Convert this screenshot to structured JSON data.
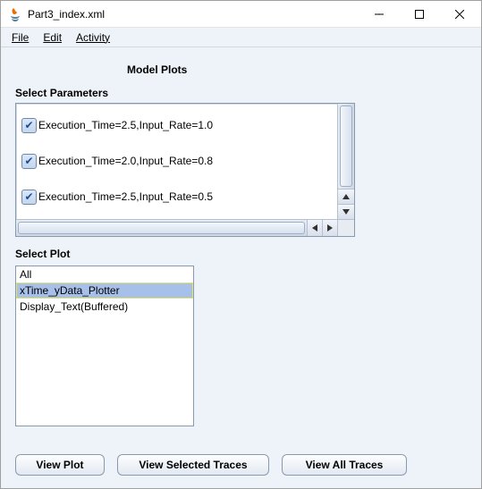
{
  "window": {
    "title": "Part3_index.xml"
  },
  "menu": {
    "file": "File",
    "edit": "Edit",
    "activity": "Activity"
  },
  "headings": {
    "model_plots": "Model Plots",
    "select_parameters": "Select Parameters",
    "select_plot": "Select Plot"
  },
  "parameters": [
    {
      "label": "Execution_Time=2.5,Input_Rate=1.0",
      "checked": true
    },
    {
      "label": "Execution_Time=2.0,Input_Rate=0.8",
      "checked": true
    },
    {
      "label": "Execution_Time=2.5,Input_Rate=0.5",
      "checked": true
    }
  ],
  "plots": [
    {
      "label": "All",
      "selected": false
    },
    {
      "label": "xTime_yData_Plotter",
      "selected": true
    },
    {
      "label": "Display_Text(Buffered)",
      "selected": false
    }
  ],
  "buttons": {
    "view_plot": "View Plot",
    "view_selected_traces": "View Selected Traces",
    "view_all_traces": "View All Traces"
  }
}
